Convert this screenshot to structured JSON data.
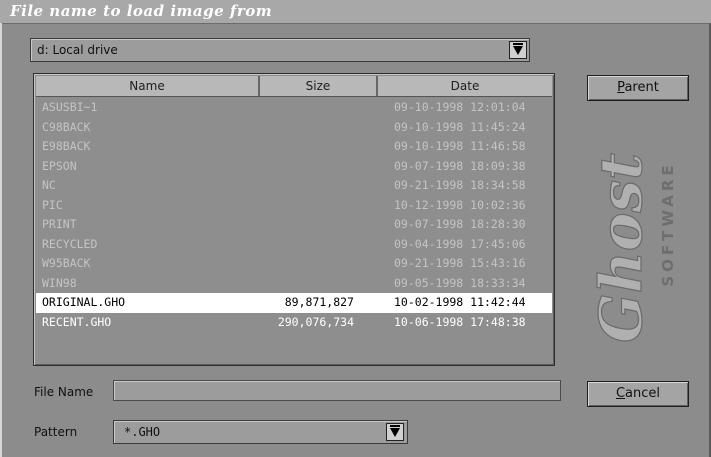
{
  "window": {
    "title": "File name to load image from"
  },
  "drive": {
    "value": "d: Local drive"
  },
  "columns": {
    "name": "Name",
    "size": "Size",
    "date": "Date"
  },
  "rows": [
    {
      "name": "ASUSBI~1",
      "size": "",
      "date": "09-10-1998 12:01:04",
      "kind": "dir"
    },
    {
      "name": "C98BACK",
      "size": "",
      "date": "09-10-1998 11:45:24",
      "kind": "dir"
    },
    {
      "name": "E98BACK",
      "size": "",
      "date": "09-10-1998 11:46:58",
      "kind": "dir"
    },
    {
      "name": "EPSON",
      "size": "",
      "date": "09-07-1998 18:09:38",
      "kind": "dir"
    },
    {
      "name": "NC",
      "size": "",
      "date": "09-21-1998 18:34:58",
      "kind": "dir"
    },
    {
      "name": "PIC",
      "size": "",
      "date": "10-12-1998 10:02:36",
      "kind": "dir"
    },
    {
      "name": "PRINT",
      "size": "",
      "date": "09-07-1998 18:28:30",
      "kind": "dir"
    },
    {
      "name": "RECYCLED",
      "size": "",
      "date": "09-04-1998 17:45:06",
      "kind": "dir"
    },
    {
      "name": "W95BACK",
      "size": "",
      "date": "09-21-1998 15:43:16",
      "kind": "dir"
    },
    {
      "name": "WIN98",
      "size": "",
      "date": "09-05-1998 18:33:34",
      "kind": "dir"
    },
    {
      "name": "ORIGINAL.GHO",
      "size": "89,871,827",
      "date": "10-02-1998 11:42:44",
      "kind": "file",
      "selected": true
    },
    {
      "name": "RECENT.GHO",
      "size": "290,076,734",
      "date": "10-06-1998 17:48:38",
      "kind": "file"
    }
  ],
  "buttons": {
    "parent": {
      "underline": "P",
      "rest": "arent"
    },
    "cancel": {
      "underline": "C",
      "rest": "ancel"
    }
  },
  "logo": {
    "main": "Ghost",
    "sub": "SOFTWARE"
  },
  "file_name": {
    "label": "File Name",
    "value": ""
  },
  "pattern": {
    "label": "Pattern",
    "value": "*.GHO"
  },
  "colors": {
    "background": "#8c8c8c",
    "selection": "#ffffff",
    "directory_text": "#c4c4c4",
    "file_text": "#ffffff"
  },
  "icons": {
    "dropdown": "dropdown-arrow-icon"
  }
}
